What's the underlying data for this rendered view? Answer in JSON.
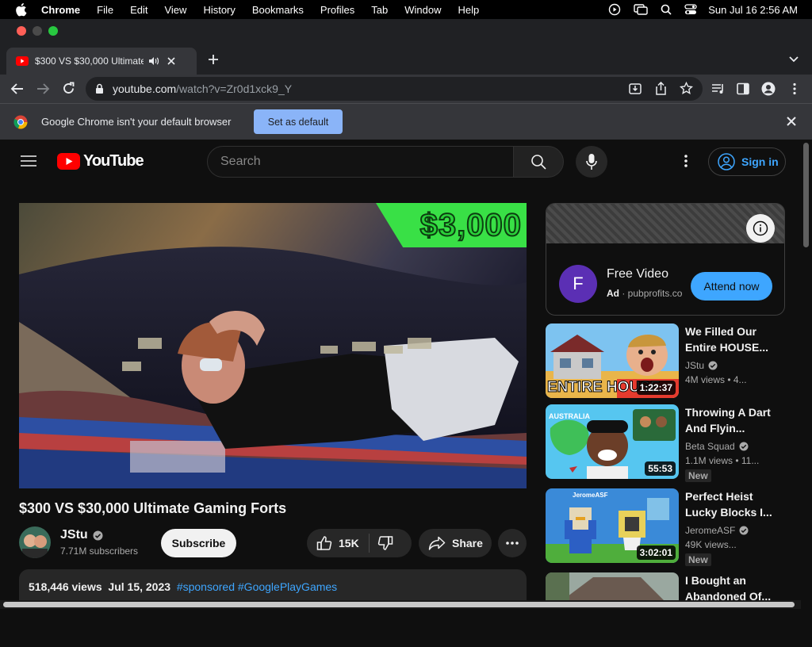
{
  "menubar": {
    "app": "Chrome",
    "items": [
      "File",
      "Edit",
      "View",
      "History",
      "Bookmarks",
      "Profiles",
      "Tab",
      "Window",
      "Help"
    ],
    "clock": "Sun Jul 16  2:56 AM"
  },
  "tab": {
    "title": "$300 VS $30,000 Ultimate"
  },
  "omnibox": {
    "host": "youtube.com",
    "path": "/watch?v=Zr0d1xck9_Y"
  },
  "infobar": {
    "message": "Google Chrome isn't your default browser",
    "button": "Set as default"
  },
  "youtube": {
    "wordmark": "YouTube",
    "search_placeholder": "Search",
    "signin": "Sign in"
  },
  "video": {
    "overlay_price": "$3,000",
    "title": "$300 VS $30,000 Ultimate Gaming Forts",
    "channel": "JStu",
    "subscribers": "7.71M subscribers",
    "subscribe": "Subscribe",
    "likes": "15K",
    "share": "Share",
    "views": "518,446 views",
    "date": "Jul 15, 2023",
    "hashtags": [
      "#sponsored",
      "#GooglePlayGames"
    ]
  },
  "ad": {
    "avatar_letter": "F",
    "title": "Free Video",
    "label": "Ad",
    "domain": "pubprofits.co",
    "cta": "Attend now"
  },
  "recommendations": [
    {
      "title": "We Filled Our Entire HOUSE...",
      "channel": "JStu",
      "meta": "4M views • 4...",
      "duration": "1:22:37",
      "thumb_text": "ENTIRE HOUSE",
      "new": ""
    },
    {
      "title": "Throwing A Dart And Flyin...",
      "channel": "Beta Squad",
      "meta": "1.1M views • 11...",
      "duration": "55:53",
      "thumb_text": "AUSTRALIA",
      "new": "New"
    },
    {
      "title": "Perfect Heist Lucky Blocks I...",
      "channel": "JeromeASF",
      "meta": "49K views...",
      "duration": "3:02:01",
      "thumb_text": "JeromeASF",
      "new": "New"
    },
    {
      "title": "I Bought an Abandoned Of...",
      "channel": "",
      "meta": "",
      "duration": "",
      "thumb_text": "",
      "new": ""
    }
  ]
}
